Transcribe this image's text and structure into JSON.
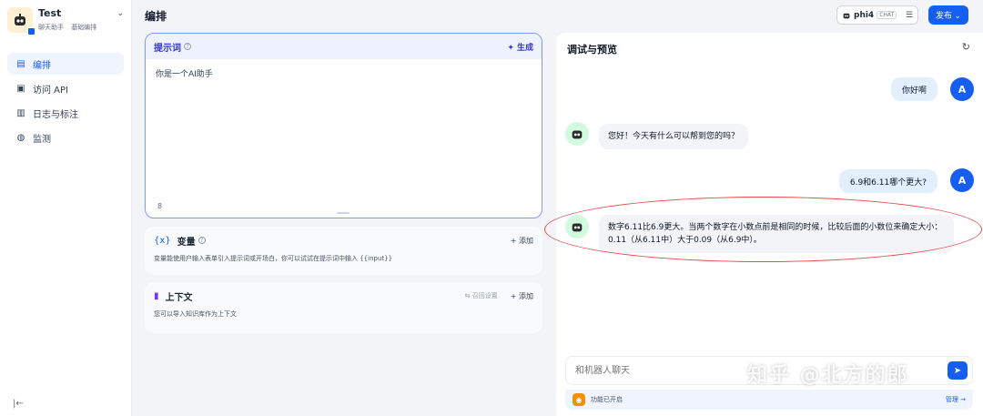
{
  "app": {
    "name": "Test",
    "tags": [
      "聊天助手",
      "基础编排"
    ],
    "chevron": "⌄"
  },
  "sidebar": {
    "items": [
      {
        "icon": "layout-icon",
        "glyph": "▤",
        "label": "编排",
        "active": true
      },
      {
        "icon": "api-icon",
        "glyph": "▣",
        "label": "访问 API"
      },
      {
        "icon": "log-icon",
        "glyph": "▥",
        "label": "日志与标注"
      },
      {
        "icon": "monitor-icon",
        "glyph": "◍",
        "label": "监测"
      }
    ],
    "collapse_glyph": "|←"
  },
  "header": {
    "title": "编排",
    "model": {
      "name": "phi4",
      "mode": "CHAT"
    },
    "publish_label": "发布 ⌄"
  },
  "prompt": {
    "label": "提示词",
    "generate_label": "✦ 生成",
    "text": "你是一个AI助手",
    "count": "8"
  },
  "variables": {
    "icon": "{x}",
    "title": "变量",
    "add_label": "+ 添加",
    "desc": "变量能使用户输入表单引入提示词或开场白，你可以试试在提示词中输入 {{input}}"
  },
  "context": {
    "title": "上下文",
    "recall_label": "⇆ 召回设置",
    "add_label": "+ 添加",
    "desc": "您可以导入知识库作为上下文"
  },
  "debug": {
    "title": "调试与预览",
    "refresh_glyph": "↻",
    "user_avatar": "A",
    "messages": [
      {
        "role": "user",
        "text": "你好啊"
      },
      {
        "role": "bot",
        "text": "您好！今天有什么可以帮到您的吗？"
      },
      {
        "role": "user",
        "text": "6.9和6.11哪个更大?"
      },
      {
        "role": "bot",
        "text": "数字6.11比6.9更大。当两个数字在小数点前是相同的时候，比较后面的小数位来确定大小：0.11（从6.11中）大于0.09（从6.9中）。"
      }
    ],
    "input_placeholder": "和机器人聊天",
    "send_glyph": "➤",
    "feature_label": "功能已开启",
    "manage_label": "管理 →"
  },
  "watermark": "知乎 @北方的郎"
}
